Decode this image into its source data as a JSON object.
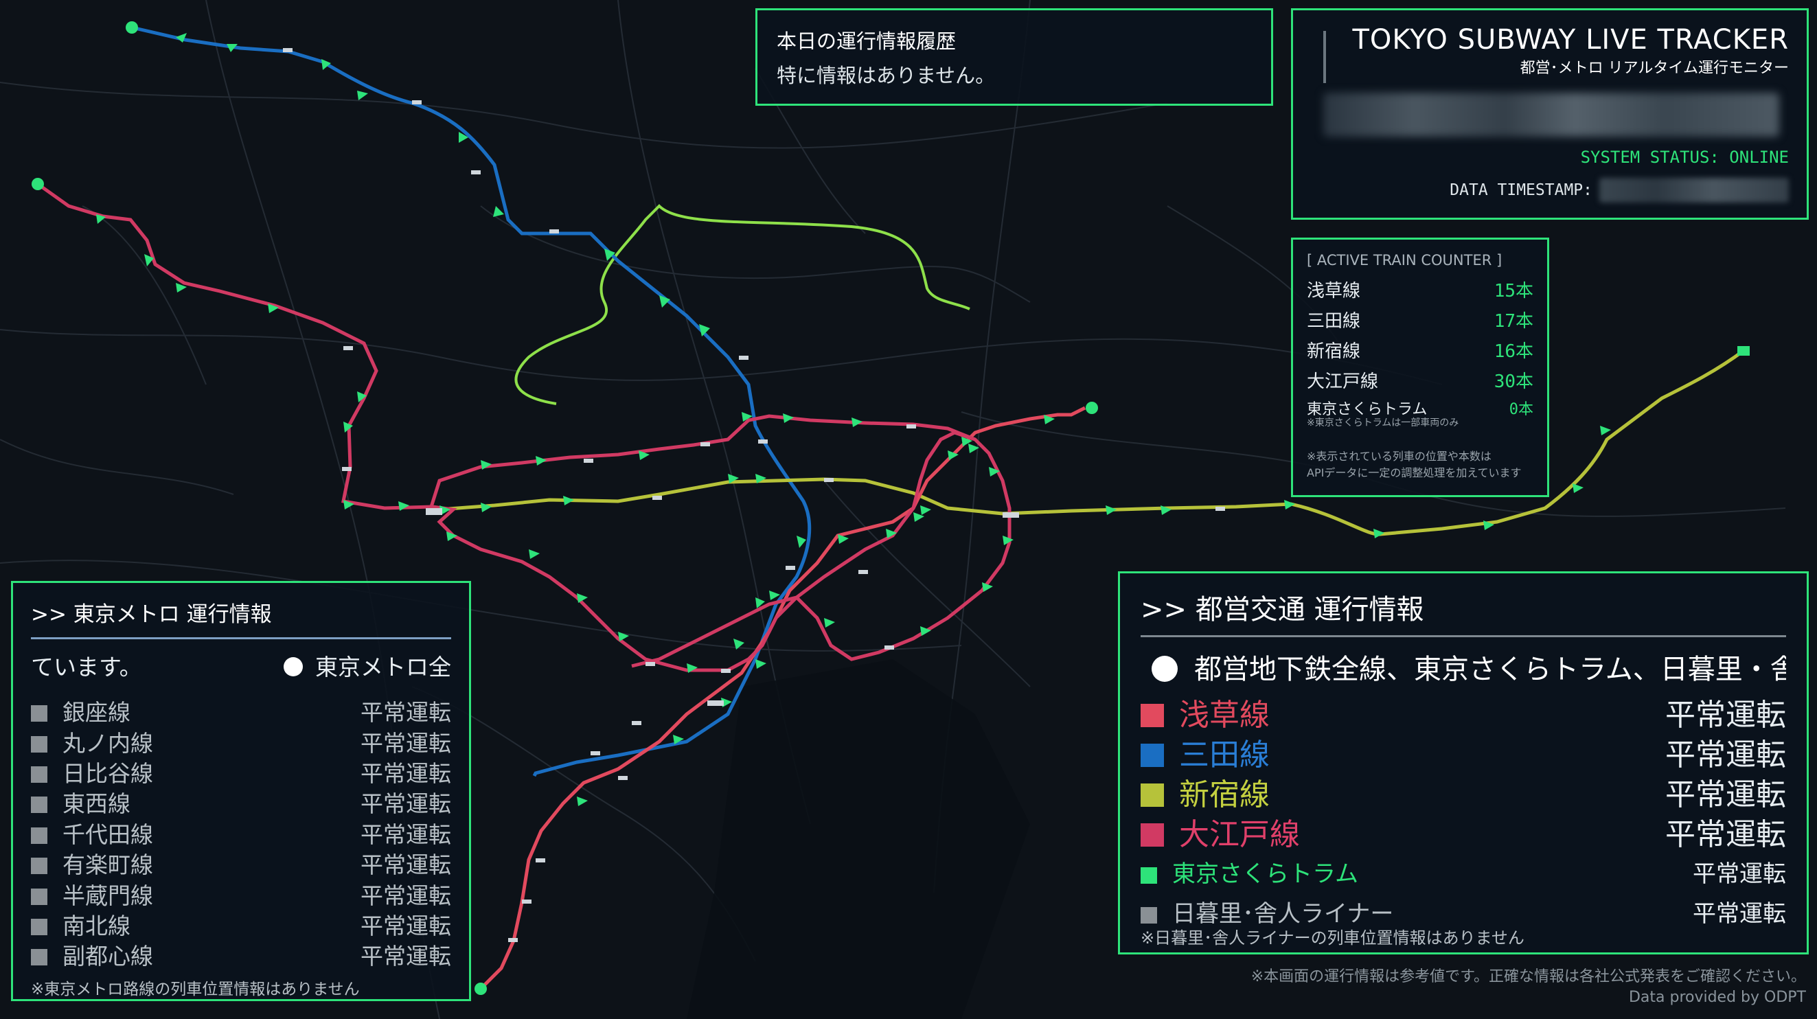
{
  "colors": {
    "accent": "#2ee37a",
    "asakusa": "#e24a5e",
    "mita": "#1a6ec2",
    "shinjuku": "#b6c23a",
    "oedo": "#d13a63",
    "sakura": "#2ee37a",
    "nippori": "#8a9095",
    "metro_gray": "#8a9095"
  },
  "history": {
    "title": "本日の運行情報履歴",
    "message": "特に情報はありません。"
  },
  "tracker": {
    "title": "TOKYO SUBWAY LIVE TRACKER",
    "subtitle": "都営･メトロ リアルタイム運行モニター",
    "status": "SYSTEM STATUS: ONLINE",
    "timestamp_label": "DATA TIMESTAMP:"
  },
  "counter": {
    "title": "[ ACTIVE TRAIN COUNTER ]",
    "rows": [
      {
        "name": "浅草線",
        "count": "15本"
      },
      {
        "name": "三田線",
        "count": "17本"
      },
      {
        "name": "新宿線",
        "count": "16本"
      },
      {
        "name": "大江戸線",
        "count": "30本"
      }
    ],
    "sakura": {
      "name": "東京さくらトラム",
      "count": "0本",
      "sub": "※東京さくらトラムは一部車両のみ"
    },
    "note_1": "※表示されている列車の位置や本数は",
    "note_2": "APIデータに一定の調整処理を加えています"
  },
  "metro": {
    "heading": ">> 東京メトロ 運行情報",
    "ticker_left": "ています。",
    "ticker_right": "東京メトロ全",
    "lines": [
      {
        "name": "銀座線",
        "status": "平常運転"
      },
      {
        "name": "丸ノ内線",
        "status": "平常運転"
      },
      {
        "name": "日比谷線",
        "status": "平常運転"
      },
      {
        "name": "東西線",
        "status": "平常運転"
      },
      {
        "name": "千代田線",
        "status": "平常運転"
      },
      {
        "name": "有楽町線",
        "status": "平常運転"
      },
      {
        "name": "半蔵門線",
        "status": "平常運転"
      },
      {
        "name": "南北線",
        "status": "平常運転"
      },
      {
        "name": "副都心線",
        "status": "平常運転"
      }
    ],
    "note": "※東京メトロ路線の列車位置情報はありません"
  },
  "toei": {
    "heading": ">> 都営交通 運行情報",
    "ticker": "都営地下鉄全線、東京さくらトラム、日暮里・舎",
    "lines": [
      {
        "name": "浅草線",
        "status": "平常運転"
      },
      {
        "name": "三田線",
        "status": "平常運転"
      },
      {
        "name": "新宿線",
        "status": "平常運転"
      },
      {
        "name": "大江戸線",
        "status": "平常運転"
      }
    ],
    "sakura": {
      "name": "東京さくらトラム",
      "status": "平常運転"
    },
    "nippori": {
      "name": "日暮里･舎人ライナー",
      "status": "平常運転"
    },
    "note": "※日暮里･舎人ライナーの列車位置情報はありません"
  },
  "footer": {
    "disclaimer": "※本画面の運行情報は参考値です。正確な情報は各社公式発表をご確認ください。",
    "credit": "Data provided by ODPT"
  }
}
